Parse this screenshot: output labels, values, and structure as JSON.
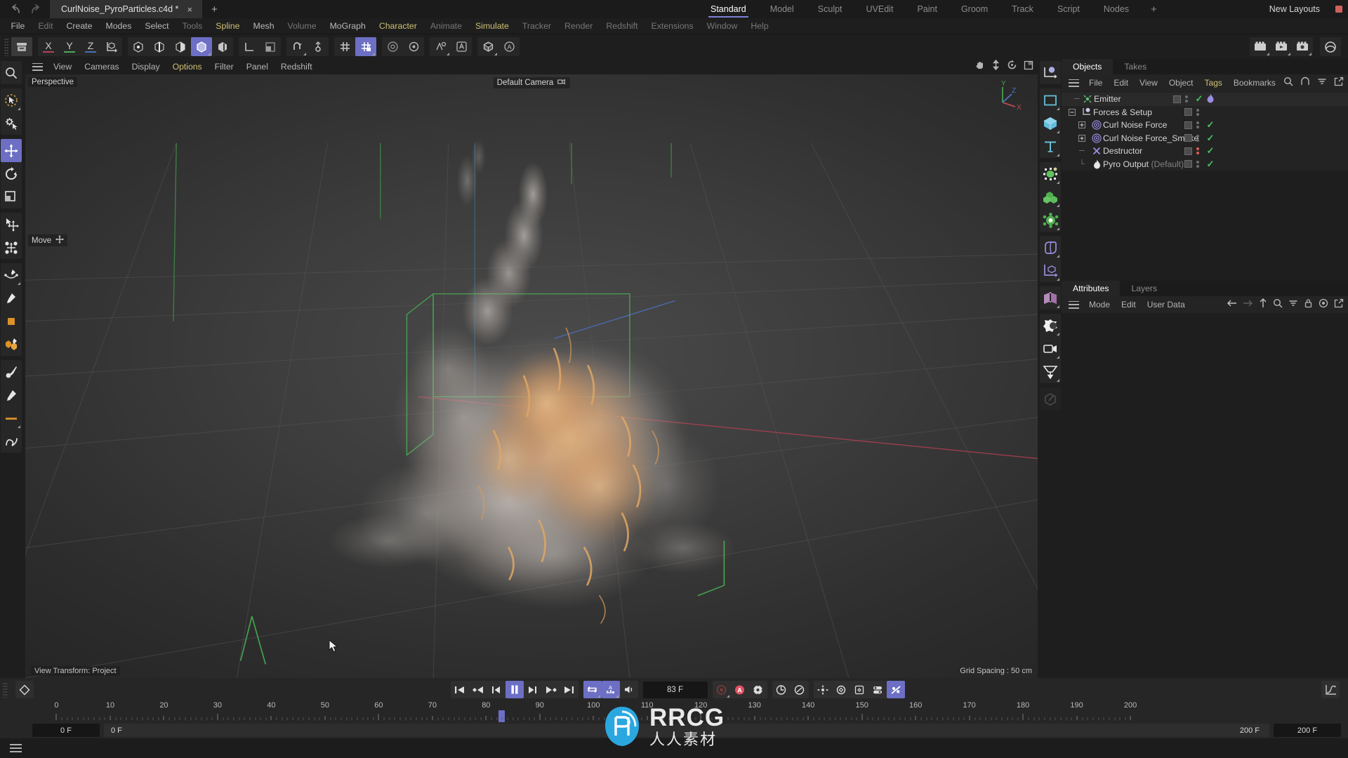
{
  "titlebar": {
    "document_tab": "CurlNoise_PyroParticles.c4d *",
    "close_label": "×",
    "new_tab_label": "+",
    "layout_tabs": [
      "Standard",
      "Model",
      "Sculpt",
      "UVEdit",
      "Paint",
      "Groom",
      "Track",
      "Script",
      "Nodes"
    ],
    "active_layout": "Standard",
    "add_layout_label": "+",
    "new_layouts_label": "New Layouts",
    "accent_color": "#7b7fd4"
  },
  "menubar": {
    "items": [
      {
        "label": "File",
        "dim": false
      },
      {
        "label": "Edit",
        "dim": true
      },
      {
        "label": "Create",
        "dim": false
      },
      {
        "label": "Modes",
        "dim": false
      },
      {
        "label": "Select",
        "dim": false
      },
      {
        "label": "Tools",
        "dim": true
      },
      {
        "label": "Spline",
        "dim": false
      },
      {
        "label": "Mesh",
        "dim": false
      },
      {
        "label": "Volume",
        "dim": true
      },
      {
        "label": "MoGraph",
        "dim": false
      },
      {
        "label": "Character",
        "dim": false,
        "highlight": true
      },
      {
        "label": "Animate",
        "dim": true
      },
      {
        "label": "Simulate",
        "dim": false,
        "highlight": true
      },
      {
        "label": "Tracker",
        "dim": true
      },
      {
        "label": "Render",
        "dim": true
      },
      {
        "label": "Redshift",
        "dim": true
      },
      {
        "label": "Extensions",
        "dim": true
      },
      {
        "label": "Window",
        "dim": true
      },
      {
        "label": "Help",
        "dim": true
      }
    ]
  },
  "toolbar": {
    "undo_icon": "undo-icon",
    "redo_icon": "redo-icon",
    "axis_labels": [
      "X",
      "Y",
      "Z"
    ],
    "axis_colors": [
      "#b5425a",
      "#4ea85a",
      "#4a6fb8"
    ],
    "world_object_icon": "world-coordinates-icon",
    "mode_icons": [
      "point-mode-icon",
      "edge-mode-icon",
      "polygon-mode-icon",
      "model-mode-icon",
      "texture-mode-icon"
    ],
    "active_mode": "model-mode-icon",
    "axis_mode_icons": [
      "axis-mode-icon",
      "workplane-icon"
    ],
    "snap_icons": [
      "enable-snap-icon",
      "snap-settings-icon"
    ],
    "grid_icons": [
      "workplane-grid-icon",
      "lock-workplane-icon"
    ],
    "active_grid": "lock-workplane-icon",
    "extra_icons": [
      "viewport-solo-icon",
      "deformer-icon",
      "material-icon",
      "annotation-icon"
    ],
    "render_icons": [
      "render-view-icon",
      "render-region-icon",
      "render-settings-icon"
    ],
    "content_browser_icon": "content-browser-icon"
  },
  "left_tools": {
    "groups": [
      [
        "magnify-icon"
      ],
      [
        "live-selection-icon",
        "selection-settings-icon"
      ],
      [
        "move-tool-icon",
        "rotate-tool-icon",
        "scale-tool-icon"
      ],
      [
        "transform-point-icon",
        "transform-multi-icon"
      ],
      [
        "spline-pen-icon",
        "spline-sketch-icon",
        "rectangle-fill-icon",
        "polygon-pen-icon"
      ],
      [
        "brush-icon",
        "knife-icon",
        "ruler-icon",
        "curve-icon"
      ]
    ],
    "active": "move-tool-icon"
  },
  "right_tools": {
    "groups": [
      [
        "null-object-icon"
      ],
      [
        "plane-primitive-icon",
        "cube-primitive-icon",
        "text-spline-icon"
      ],
      [
        "deformer-group-icon",
        "array-object-icon",
        "generator-icon"
      ],
      [
        "volume-icon",
        "workplane-object-icon"
      ],
      [
        "cloth-icon"
      ],
      [
        "particle-icon",
        "camera-icon",
        "light-icon"
      ],
      [
        "sculpt-icon"
      ]
    ]
  },
  "viewport": {
    "menu": [
      {
        "label": "View",
        "highlight": false
      },
      {
        "label": "Cameras",
        "highlight": false
      },
      {
        "label": "Display",
        "highlight": false
      },
      {
        "label": "Options",
        "highlight": true
      },
      {
        "label": "Filter",
        "highlight": false
      },
      {
        "label": "Panel",
        "highlight": false
      },
      {
        "label": "Redshift",
        "highlight": false
      }
    ],
    "nav_icons": [
      "pan-icon",
      "dolly-icon",
      "rotate-view-icon",
      "maximize-view-icon"
    ],
    "perspective_label": "Perspective",
    "camera_label": "Default Camera",
    "camera_icon": "camera-lock-icon",
    "tool_hint_label": "Move",
    "tool_hint_icon": "move-axis-icon",
    "view_transform_label": "View Transform: Project",
    "grid_spacing_label": "Grid Spacing : 50 cm",
    "axis_gizmo": {
      "x": "X",
      "y": "Y",
      "z": "Z"
    }
  },
  "objects_panel": {
    "tabs": [
      "Objects",
      "Takes"
    ],
    "active_tab": "Objects",
    "menu": [
      {
        "label": "File",
        "highlight": false
      },
      {
        "label": "Edit",
        "highlight": false
      },
      {
        "label": "View",
        "highlight": false
      },
      {
        "label": "Object",
        "highlight": false
      },
      {
        "label": "Tags",
        "highlight": true
      },
      {
        "label": "Bookmarks",
        "highlight": false
      }
    ],
    "header_icons": [
      "search-icon",
      "home-icon",
      "filter-icon",
      "open-external-icon"
    ],
    "items": [
      {
        "name": "Emitter",
        "icon": "emitter-icon",
        "indent": 0,
        "expander": "none",
        "visdots": "grey",
        "check": true,
        "extra_tag": "pyro-tag-icon",
        "suffix": ""
      },
      {
        "name": "Forces & Setup",
        "icon": "null-object-icon",
        "indent": 0,
        "expander": "minus",
        "visdots": "grey",
        "check": false,
        "extra_tag": "",
        "suffix": ""
      },
      {
        "name": "Curl Noise Force",
        "icon": "force-field-icon",
        "indent": 1,
        "expander": "plus",
        "visdots": "grey",
        "check": true,
        "extra_tag": "",
        "suffix": ""
      },
      {
        "name": "Curl Noise Force_Smoke",
        "icon": "force-field-icon",
        "indent": 1,
        "expander": "plus",
        "visdots": "grey",
        "check": true,
        "extra_tag": "",
        "suffix": ""
      },
      {
        "name": "Destructor",
        "icon": "destructor-icon",
        "indent": 1,
        "expander": "none",
        "visdots": "red",
        "check": true,
        "extra_tag": "",
        "suffix": ""
      },
      {
        "name": "Pyro Output",
        "icon": "pyro-output-icon",
        "indent": 1,
        "expander": "none",
        "visdots": "grey",
        "check": true,
        "extra_tag": "",
        "suffix": "(Default)"
      }
    ]
  },
  "attributes_panel": {
    "tabs": [
      "Attributes",
      "Layers"
    ],
    "active_tab": "Attributes",
    "menu": [
      "Mode",
      "Edit",
      "User Data"
    ],
    "header_icons": [
      "back-arrow-icon",
      "forward-arrow-icon",
      "up-arrow-icon",
      "search-icon",
      "filter-icon",
      "lock-icon",
      "record-icon",
      "open-external-icon"
    ]
  },
  "timeline": {
    "keyframe_icon": "keyframe-diamond-icon",
    "transport_icons": [
      "go-to-start-icon",
      "prev-key-icon",
      "prev-frame-icon",
      "pause-icon",
      "next-frame-icon",
      "next-key-icon",
      "go-to-end-icon"
    ],
    "active_transport": "pause-icon",
    "loop_icons": [
      "loop-playback-icon",
      "sound-waveform-icon"
    ],
    "loop_active": [
      "loop-playback-icon",
      "sound-waveform-icon"
    ],
    "sound_icon": "speaker-icon",
    "current_frame": "83 F",
    "record_icons": [
      "record-keyframe-icon",
      "autokey-icon",
      "keyframe-settings-icon"
    ],
    "key_mode_icons": [
      "key-position-icon",
      "key-scale-icon"
    ],
    "param_icons": [
      "position-key-icon",
      "rotation-key-icon",
      "scale-key-icon",
      "param-key-icon",
      "pla-key-icon"
    ],
    "param_active": "pla-key-icon",
    "curve_icon": "animation-curve-icon",
    "ruler_min": 0,
    "ruler_max": 200,
    "ruler_ticks": [
      0,
      10,
      20,
      30,
      40,
      50,
      60,
      70,
      80,
      90,
      100,
      110,
      120,
      130,
      140,
      150,
      160,
      170,
      180,
      190,
      200
    ],
    "playhead_frame": 83,
    "range_start_field": "0 F",
    "range_preview_start": "0 F",
    "range_preview_end": "200 F",
    "range_end_field": "200 F"
  },
  "statusbar": {
    "menu_icon": "hamburger-icon"
  },
  "watermark": {
    "text": "RRCG",
    "subtext": "人人素材",
    "color": "#2ba7e0"
  }
}
